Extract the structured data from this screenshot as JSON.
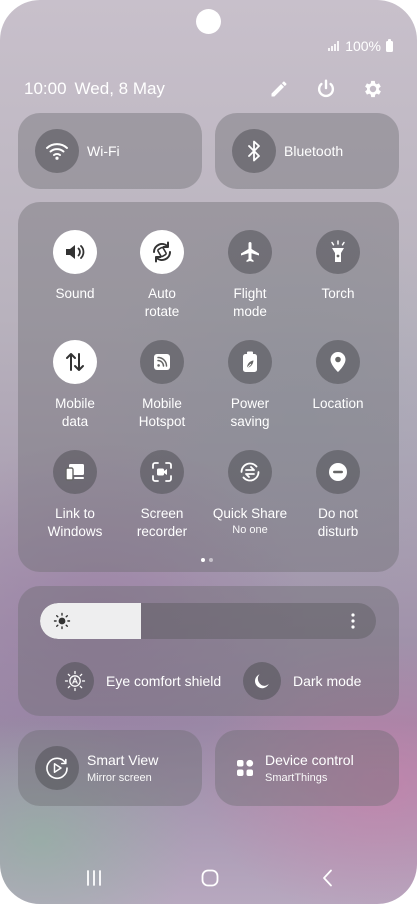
{
  "status": {
    "battery": "100%"
  },
  "header": {
    "time": "10:00",
    "date": "Wed, 8 May"
  },
  "connectivity": {
    "wifi": {
      "label": "Wi-Fi"
    },
    "bluetooth": {
      "label": "Bluetooth"
    }
  },
  "tiles": [
    {
      "label": "Sound",
      "sub": "",
      "icon": "speaker-icon",
      "active": true
    },
    {
      "label": "Auto\nrotate",
      "sub": "",
      "icon": "auto-rotate-icon",
      "active": true
    },
    {
      "label": "Flight\nmode",
      "sub": "",
      "icon": "airplane-icon",
      "active": false
    },
    {
      "label": "Torch",
      "sub": "",
      "icon": "torch-icon",
      "active": false
    },
    {
      "label": "Mobile\ndata",
      "sub": "",
      "icon": "mobile-data-icon",
      "active": true
    },
    {
      "label": "Mobile\nHotspot",
      "sub": "",
      "icon": "hotspot-icon",
      "active": false
    },
    {
      "label": "Power\nsaving",
      "sub": "",
      "icon": "battery-leaf-icon",
      "active": false
    },
    {
      "label": "Location",
      "sub": "",
      "icon": "location-pin-icon",
      "active": false
    },
    {
      "label": "Link to\nWindows",
      "sub": "",
      "icon": "link-windows-icon",
      "active": false
    },
    {
      "label": "Screen\nrecorder",
      "sub": "",
      "icon": "screen-recorder-icon",
      "active": false
    },
    {
      "label": "Quick Share",
      "sub": "No one",
      "icon": "quick-share-icon",
      "active": false
    },
    {
      "label": "Do not\ndisturb",
      "sub": "",
      "icon": "do-not-disturb-icon",
      "active": false
    }
  ],
  "brightness": {
    "level_percent": 30
  },
  "display_options": {
    "eye_comfort": "Eye comfort shield",
    "dark_mode": "Dark mode"
  },
  "bottom_cards": {
    "smart_view": {
      "title": "Smart View",
      "subtitle": "Mirror screen"
    },
    "device_control": {
      "title": "Device control",
      "subtitle": "SmartThings"
    }
  },
  "colors": {
    "active_tile": "#ffffff",
    "tile_bg": "#5a5a60",
    "card_bg": "#6e6e73"
  }
}
